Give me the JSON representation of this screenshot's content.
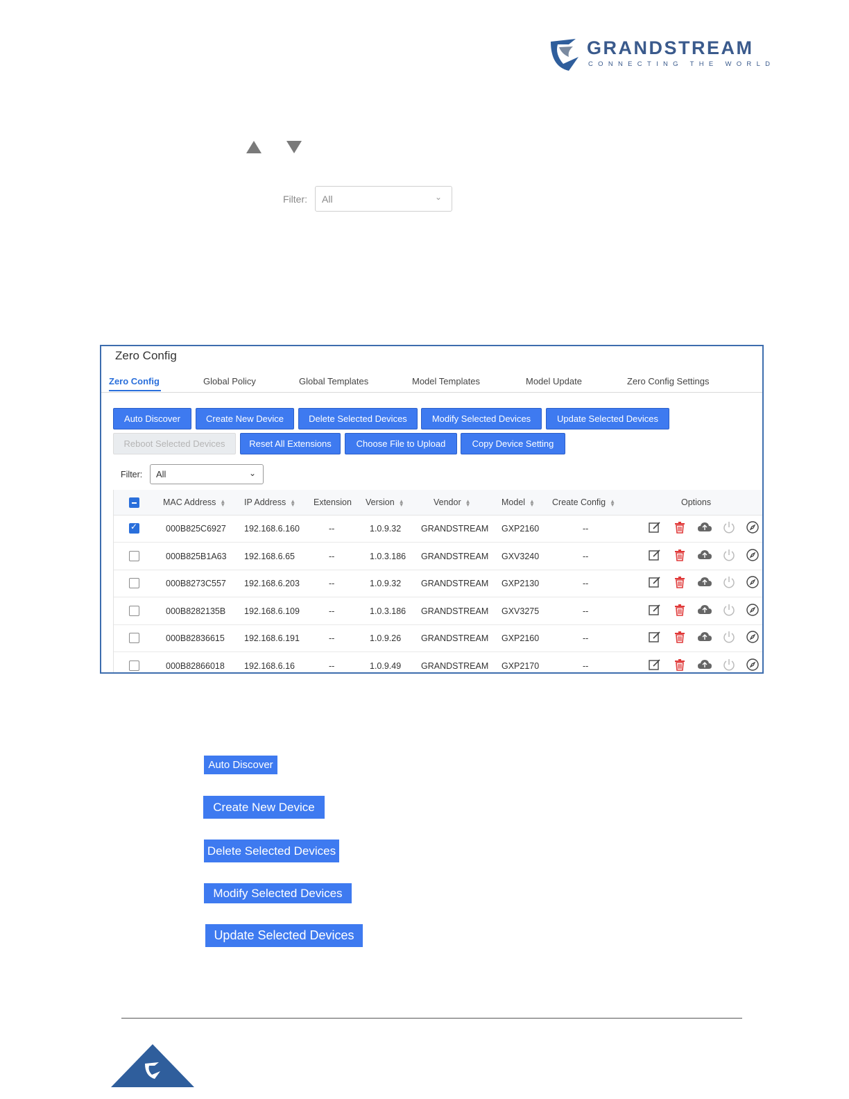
{
  "brand": {
    "name": "GRANDSTREAM",
    "tagline": "CONNECTING THE WORLD"
  },
  "filter_top": {
    "label": "Filter:",
    "value": "All"
  },
  "panel": {
    "title": "Zero Config",
    "tabs": [
      "Zero Config",
      "Global Policy",
      "Global Templates",
      "Model Templates",
      "Model Update",
      "Zero Config Settings"
    ],
    "buttons_row1": [
      "Auto Discover",
      "Create New Device",
      "Delete Selected Devices",
      "Modify Selected Devices",
      "Update Selected Devices"
    ],
    "buttons_row2": [
      "Reboot Selected Devices",
      "Reset All Extensions",
      "Choose File to Upload",
      "Copy Device Setting"
    ],
    "filter": {
      "label": "Filter:",
      "value": "All"
    },
    "columns": [
      "MAC Address",
      "IP Address",
      "Extension",
      "Version",
      "Vendor",
      "Model",
      "Create Config",
      "Options"
    ],
    "rows": [
      {
        "mac": "000B825C6927",
        "ip": "192.168.6.160",
        "ext": "--",
        "version": "1.0.9.32",
        "vendor": "GRANDSTREAM",
        "model": "GXP2160",
        "config": "--"
      },
      {
        "mac": "000B825B1A63",
        "ip": "192.168.6.65",
        "ext": "--",
        "version": "1.0.3.186",
        "vendor": "GRANDSTREAM",
        "model": "GXV3240",
        "config": "--"
      },
      {
        "mac": "000B8273C557",
        "ip": "192.168.6.203",
        "ext": "--",
        "version": "1.0.9.32",
        "vendor": "GRANDSTREAM",
        "model": "GXP2130",
        "config": "--"
      },
      {
        "mac": "000B8282135B",
        "ip": "192.168.6.109",
        "ext": "--",
        "version": "1.0.3.186",
        "vendor": "GRANDSTREAM",
        "model": "GXV3275",
        "config": "--"
      },
      {
        "mac": "000B82836615",
        "ip": "192.168.6.191",
        "ext": "--",
        "version": "1.0.9.26",
        "vendor": "GRANDSTREAM",
        "model": "GXP2160",
        "config": "--"
      },
      {
        "mac": "000B82866018",
        "ip": "192.168.6.16",
        "ext": "--",
        "version": "1.0.9.49",
        "vendor": "GRANDSTREAM",
        "model": "GXP2170",
        "config": "--"
      }
    ],
    "row_checked": [
      true,
      false,
      false,
      false,
      false,
      false
    ]
  },
  "standalone_buttons": [
    "Auto Discover",
    "Create New Device",
    "Delete Selected Devices",
    "Modify Selected Devices",
    "Update Selected Devices"
  ],
  "icons": [
    "edit-icon",
    "trash-icon",
    "cloud-upload-icon",
    "power-icon",
    "compass-icon"
  ],
  "colors": {
    "accent": "#3e7af0",
    "brand": "#3a5a8c",
    "delete": "#e03a3a"
  }
}
